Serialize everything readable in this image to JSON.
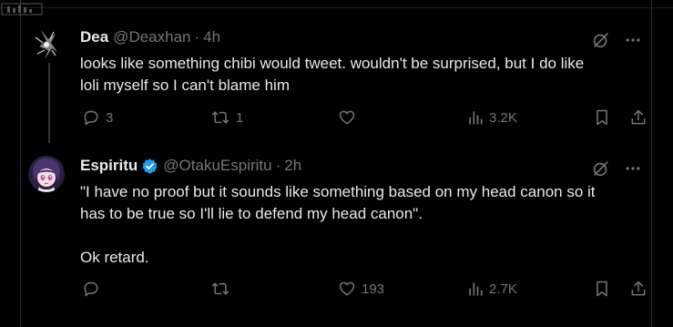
{
  "tweets": [
    {
      "display_name": "Dea",
      "handle": "@Deaxhan",
      "separator": "·",
      "time": "4h",
      "verified": false,
      "text": "looks like something chibi would tweet. wouldn't be surprised, but I do like\nloli myself so I can't blame him",
      "replies": "3",
      "reposts": "1",
      "likes": "",
      "views": "3.2K"
    },
    {
      "display_name": "Espiritu",
      "handle": "@OtakuEspiritu",
      "separator": "·",
      "time": "2h",
      "verified": true,
      "text": "\"I have no proof but it sounds like something based on my head canon so it\nhas to be true so I'll lie to defend my head canon\".\n\nOk retard.",
      "replies": "",
      "reposts": "",
      "likes": "193",
      "views": "2.7K"
    }
  ],
  "colors": {
    "background": "#000000",
    "text": "#e7e9ea",
    "secondary": "#71767b",
    "verified": "#1d9bf0",
    "divider": "#2f3336"
  },
  "icons": [
    "grok-icon",
    "more-icon",
    "reply-icon",
    "repost-icon",
    "like-icon",
    "views-icon",
    "bookmark-icon",
    "share-icon",
    "verified-icon"
  ]
}
